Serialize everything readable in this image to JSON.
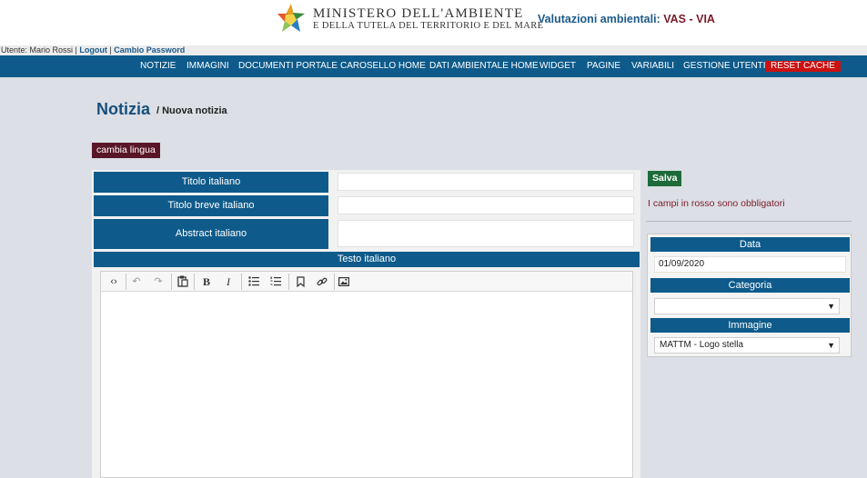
{
  "header": {
    "logo_line1": "MINISTERO DELL'AMBIENTE",
    "logo_line2": "E DELLA TUTELA DEL TERRITORIO E DEL MARE",
    "app_title_prefix": "Valutazioni ambientali:",
    "app_title_suffix": "VAS - VIA",
    "logo_colors": [
      "#e6a11f",
      "#3a8a3f",
      "#2b7fc1",
      "#8fc45a",
      "#e05a2a"
    ]
  },
  "userbar": {
    "user_text": "Utente: Mario Rossi",
    "separator": "|",
    "logout": "Logout",
    "change_password": "Cambio Password"
  },
  "nav": {
    "items": [
      "NOTIZIE",
      "IMMAGINI",
      "DOCUMENTI PORTALE",
      "CAROSELLO HOME",
      "DATI AMBIENTALE HOME",
      "WIDGET",
      "PAGINE",
      "VARIABILI",
      "GESTIONE UTENTI"
    ],
    "reset": "RESET CACHE"
  },
  "page": {
    "title": "Notizia",
    "subtitle": "/ Nuova notizia"
  },
  "form": {
    "change_language": "cambia lingua",
    "title_label": "Titolo italiano",
    "title_value": "",
    "short_title_label": "Titolo breve italiano",
    "short_title_value": "",
    "abstract_label": "Abstract italiano",
    "abstract_value": "",
    "text_label": "Testo italiano"
  },
  "editor": {
    "toolbar_icons": [
      "source-code-icon",
      "undo-icon",
      "redo-icon",
      "paste-icon",
      "bold-icon",
      "italic-icon",
      "bulleted-list-icon",
      "numbered-list-icon",
      "bookmark-icon",
      "link-icon",
      "image-icon"
    ]
  },
  "sidebar": {
    "save": "Salva",
    "required_note": "I campi in rosso sono obbligatori",
    "date_label": "Data",
    "date_value": "01/09/2020",
    "category_label": "Categoria",
    "category_value": "",
    "image_label": "Immagine",
    "image_value": "MATTM - Logo stella"
  },
  "colors": {
    "primary": "#0e5b8b",
    "accent": "#7a1a2a",
    "save_green": "#1e6b3a",
    "reset_red": "#cc1111",
    "language_button": "#5a1629"
  }
}
